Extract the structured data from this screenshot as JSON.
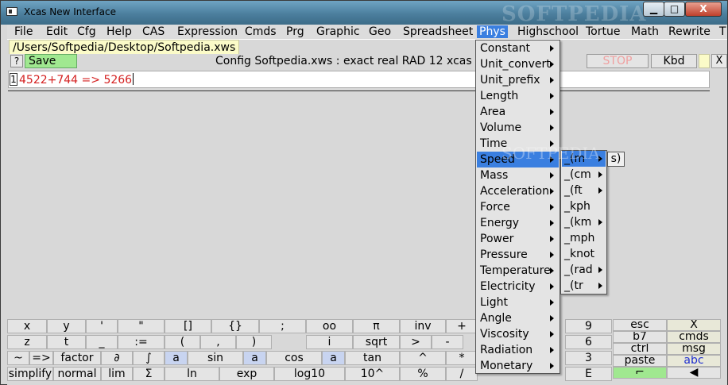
{
  "window": {
    "title": "Xcas New Interface",
    "watermark": "SOFTPEDIA",
    "min_label": "▁",
    "max_label": "□",
    "close_label": "X"
  },
  "menubar": [
    "File",
    "Edit",
    "Cfg",
    "Help",
    "CAS",
    "Expression",
    "Cmds",
    "Prg",
    "Graphic",
    "Geo",
    "Spreadsheet",
    "Phys",
    "Highschool",
    "Tortue",
    "Math",
    "Rewrite",
    "T"
  ],
  "active_menu": "Phys",
  "file_tab": "/Users/Softpedia/Desktop/Softpedia.xws",
  "toolbar": {
    "help_label": "?",
    "save_label": "Save",
    "config_text": "Config Softpedia.xws : exact real RAD 12 xcas",
    "stop_label": "STOP",
    "kbd_label": "Kbd",
    "close_label": "X"
  },
  "session": {
    "entry_number": "1",
    "entry_text": "4522+744 => 5266"
  },
  "phys_menu": [
    "Constant",
    "Unit_convert",
    "Unit_prefix",
    "Length",
    "Area",
    "Volume",
    "Time",
    "Speed",
    "Mass",
    "Acceleration",
    "Force",
    "Energy",
    "Power",
    "Pressure",
    "Temperature",
    "Electricity",
    "Light",
    "Angle",
    "Viscosity",
    "Radiation",
    "Monetary"
  ],
  "phys_selected": "Speed",
  "speed_submenu": [
    "_(m",
    "_(cm",
    "_(ft",
    "_kph",
    "_(km",
    "_mph",
    "_knot",
    "_(rad",
    "_(tr"
  ],
  "speed_submenu_has_arrow": [
    true,
    true,
    true,
    false,
    true,
    false,
    false,
    true,
    true
  ],
  "speed_sub_selected": "_(m",
  "sub3_item": "s)",
  "keypad": {
    "row1": [
      "x",
      "y",
      "'",
      "\"",
      "[]",
      "{}",
      ";",
      "oo",
      "π",
      "inv",
      "+"
    ],
    "row2": [
      "z",
      "t",
      "_",
      ":=",
      "(",
      ",",
      ")",
      "i",
      "sqrt",
      ">",
      "-"
    ],
    "row3": [
      "~",
      "=>",
      "factor",
      "∂",
      "∫",
      "a",
      "sin",
      "a",
      "cos",
      "a",
      "tan",
      "^",
      "*"
    ],
    "row4": [
      "simplify",
      "normal",
      "lim",
      "Σ",
      "ln",
      "exp",
      "log10",
      "10^",
      "%",
      "/"
    ],
    "digits": [
      "9",
      "6",
      "3",
      "E"
    ],
    "right_col1": [
      "esc",
      "b7",
      "ctrl",
      "paste",
      "⌐"
    ],
    "right_col2": [
      "X",
      "cmds",
      "msg",
      "abc",
      "◀"
    ]
  },
  "colors": {
    "accent": "#3a7fe0",
    "save_green": "#a0e890",
    "entry_red": "#d42020",
    "tab_yellow": "#fbfbc8",
    "stop_pink": "#f0a0a0"
  }
}
